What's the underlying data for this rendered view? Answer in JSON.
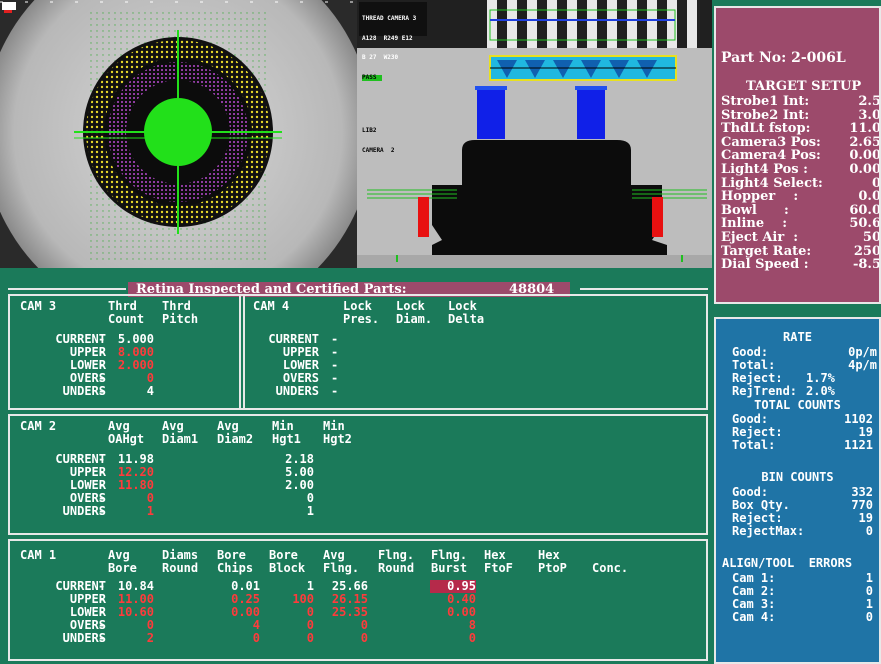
{
  "overlay": {
    "thread_camera": "THREAD CAMERA 3",
    "thread_line2": "A128  R249 E12",
    "thread_line3": "B 27  W230",
    "thread_pass": "PASS",
    "lib_label": "LIB2",
    "camera2_label": "CAMERA  2"
  },
  "banner": {
    "label": "Retina Inspected and Certified Parts:",
    "count": "48804"
  },
  "target": {
    "part_no": "Part No: 2-006L",
    "title": "TARGET SETUP",
    "rows": [
      {
        "label": "Strobe1 Int:",
        "value": "2.5"
      },
      {
        "label": "Strobe2 Int:",
        "value": "3.0"
      },
      {
        "label": "ThdLt fstop:",
        "value": "11.0"
      },
      {
        "label": "Camera3 Pos:",
        "value": "2.65"
      },
      {
        "label": "Camera4 Pos:",
        "value": "0.00"
      },
      {
        "label": "Light4 Pos :",
        "value": "0.00"
      },
      {
        "label": "Light4 Select:",
        "value": "0"
      },
      {
        "label": "Hopper    :",
        "value": "0.0"
      },
      {
        "label": "Bowl      :",
        "value": "60.0"
      },
      {
        "label": "Inline    :",
        "value": "50.6"
      },
      {
        "label": "Eject Air  :",
        "value": "50"
      },
      {
        "label": "Target Rate:",
        "value": "250"
      },
      {
        "label": "Dial Speed :",
        "value": "-8.5"
      }
    ]
  },
  "rate": {
    "title": "RATE",
    "good_label": "Good:",
    "good_value": "0p/m",
    "total_label": "Total:",
    "total_value": "4p/m",
    "reject_label": "Reject:",
    "reject_value": "1.7%",
    "rejtrend_label": "RejTrend:",
    "rejtrend_value": "2.0%",
    "total_counts_title": "TOTAL COUNTS",
    "tc_good_label": "Good:",
    "tc_good_value": "1102",
    "tc_reject_label": "Reject:",
    "tc_reject_value": "19",
    "tc_total_label": "Total:",
    "tc_total_value": "1121",
    "bin_title": "BIN COUNTS",
    "bin_good_label": "Good:",
    "bin_good_value": "332",
    "bin_box_label": "Box Qty.",
    "bin_box_value": "770",
    "bin_reject_label": "Reject:",
    "bin_reject_value": "19",
    "bin_rejmax_label": "RejectMax:",
    "bin_rejmax_value": "0",
    "align_title": "ALIGN/TOOL  ERRORS",
    "cams": [
      {
        "label": "Cam 1:",
        "value": "1"
      },
      {
        "label": "Cam 2:",
        "value": "0"
      },
      {
        "label": "Cam 3:",
        "value": "1"
      },
      {
        "label": "Cam 4:",
        "value": "0"
      }
    ]
  },
  "rowlabels": [
    "CURRENT",
    "UPPER",
    "LOWER",
    "OVERS",
    "UNDERS"
  ],
  "dash": "-",
  "cam3": {
    "title": "CAM 3",
    "headers": [
      [
        "Thrd",
        "Count"
      ],
      [
        "Thrd",
        "Pitch"
      ]
    ],
    "values": [
      "5.000",
      "8.000",
      "2.000",
      "0",
      "4"
    ]
  },
  "cam4": {
    "title": "CAM 4",
    "headers": [
      [
        "Lock",
        "Pres."
      ],
      [
        "Lock",
        "Diam."
      ],
      [
        "Lock",
        "Delta"
      ]
    ]
  },
  "cam2": {
    "title": "CAM 2",
    "headers": [
      [
        "Avg",
        "OAHgt"
      ],
      [
        "Avg",
        "Diam1"
      ],
      [
        "Avg",
        "Diam2"
      ],
      [
        "Min",
        "Hgt1"
      ],
      [
        "Min",
        "Hgt2"
      ]
    ],
    "col1": [
      "11.98",
      "12.20",
      "11.80",
      "0",
      "1"
    ],
    "col4": [
      "2.18",
      "5.00",
      "2.00",
      "0",
      "1"
    ]
  },
  "cam1": {
    "title": "CAM 1",
    "headers": [
      [
        "Avg",
        "Bore"
      ],
      [
        "Diams",
        "Round"
      ],
      [
        "Bore",
        "Chips"
      ],
      [
        "Bore",
        "Block"
      ],
      [
        "Avg",
        "Flng."
      ],
      [
        "Flng.",
        "Round"
      ],
      [
        "Flng.",
        "Burst"
      ],
      [
        "Hex",
        "FtoF"
      ],
      [
        "Hex",
        "PtoP"
      ],
      [
        "",
        "Conc."
      ]
    ],
    "col1": [
      "10.84",
      "11.00",
      "10.60",
      "0",
      "2"
    ],
    "col3": [
      "0.01",
      "0.25",
      "0.00",
      "4",
      "0"
    ],
    "col4": [
      "1",
      "100",
      "0",
      "0",
      "0"
    ],
    "col5": [
      "25.66",
      "26.15",
      "25.35",
      "0",
      "0"
    ],
    "col7": [
      "0.95",
      "0.40",
      "0.00",
      "8",
      "0"
    ]
  }
}
